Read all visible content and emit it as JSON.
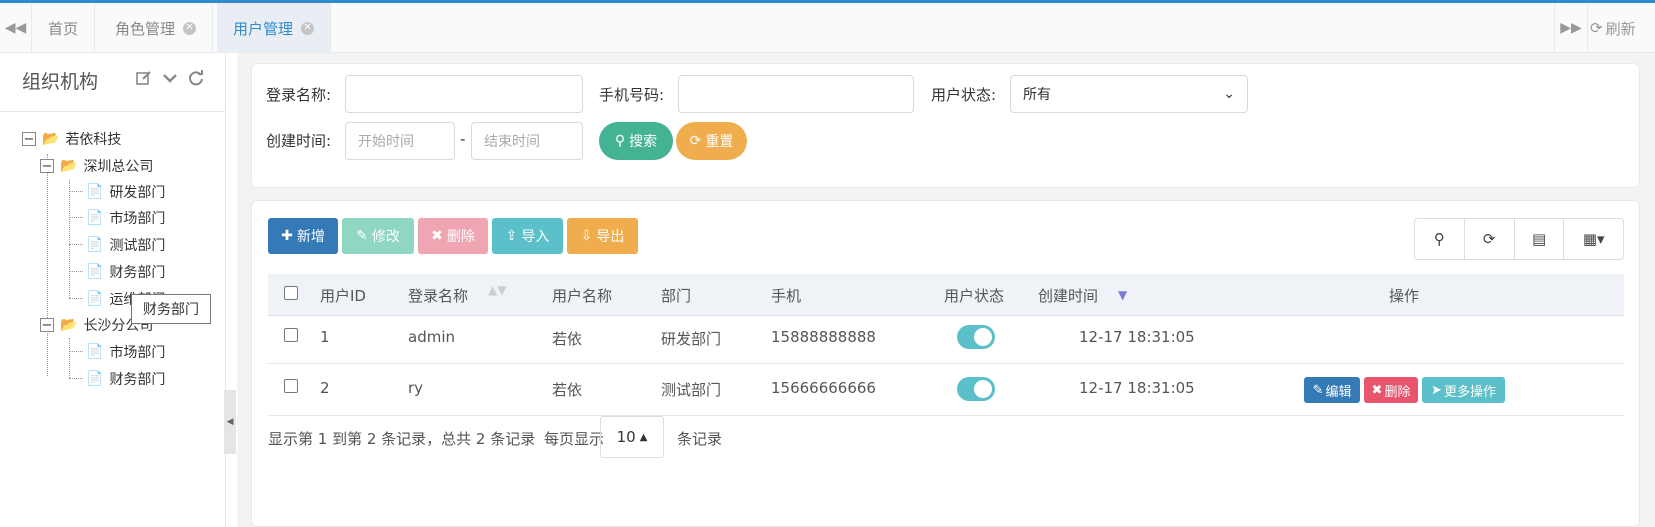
{
  "tabs": {
    "items": [
      "首页",
      "角色管理",
      "用户管理"
    ],
    "refresh_label": "刷新"
  },
  "sidebar": {
    "title": "组织机构",
    "tree": {
      "root": "若依科技",
      "shenzhen": "深圳总公司",
      "sz_children": [
        "研发部门",
        "市场部门",
        "测试部门",
        "财务部门",
        "运维部门"
      ],
      "changsha": "长沙分公司",
      "cs_children": [
        "市场部门",
        "财务部门"
      ]
    },
    "tooltip": "财务部门"
  },
  "search": {
    "login_label": "登录名称:",
    "phone_label": "手机号码:",
    "status_label": "用户状态:",
    "status_value": "所有",
    "created_label": "创建时间:",
    "start_placeholder": "开始时间",
    "end_placeholder": "结束时间",
    "separator": "-",
    "search_button": "搜索",
    "reset_button": "重置"
  },
  "toolbar": {
    "add": "新增",
    "edit": "修改",
    "delete": "删除",
    "import": "导入",
    "export": "导出"
  },
  "table": {
    "headers": [
      "用户ID",
      "登录名称",
      "用户名称",
      "部门",
      "手机",
      "用户状态",
      "创建时间",
      "操作"
    ],
    "rows": [
      {
        "id": "1",
        "login": "admin",
        "name": "若依",
        "dept": "研发部门",
        "phone": "15888888888",
        "status": "on",
        "created": "12-17 18:31:05"
      },
      {
        "id": "2",
        "login": "ry",
        "name": "若依",
        "dept": "测试部门",
        "phone": "15666666666",
        "status": "on",
        "created": "12-17 18:31:05"
      }
    ],
    "actions": {
      "edit": "编辑",
      "delete": "删除",
      "more": "更多操作"
    }
  },
  "pager": {
    "summary": "显示第 1 到第 2 条记录，总共 2 条记录",
    "per_page_prefix": "每页显示",
    "page_size": "10",
    "per_page_suffix": "条记录"
  },
  "colors": {
    "primary": "#337ab7",
    "info": "#5bc0c9",
    "danger": "#e8566e",
    "warning": "#f0ad4e",
    "success": "#44b394"
  }
}
